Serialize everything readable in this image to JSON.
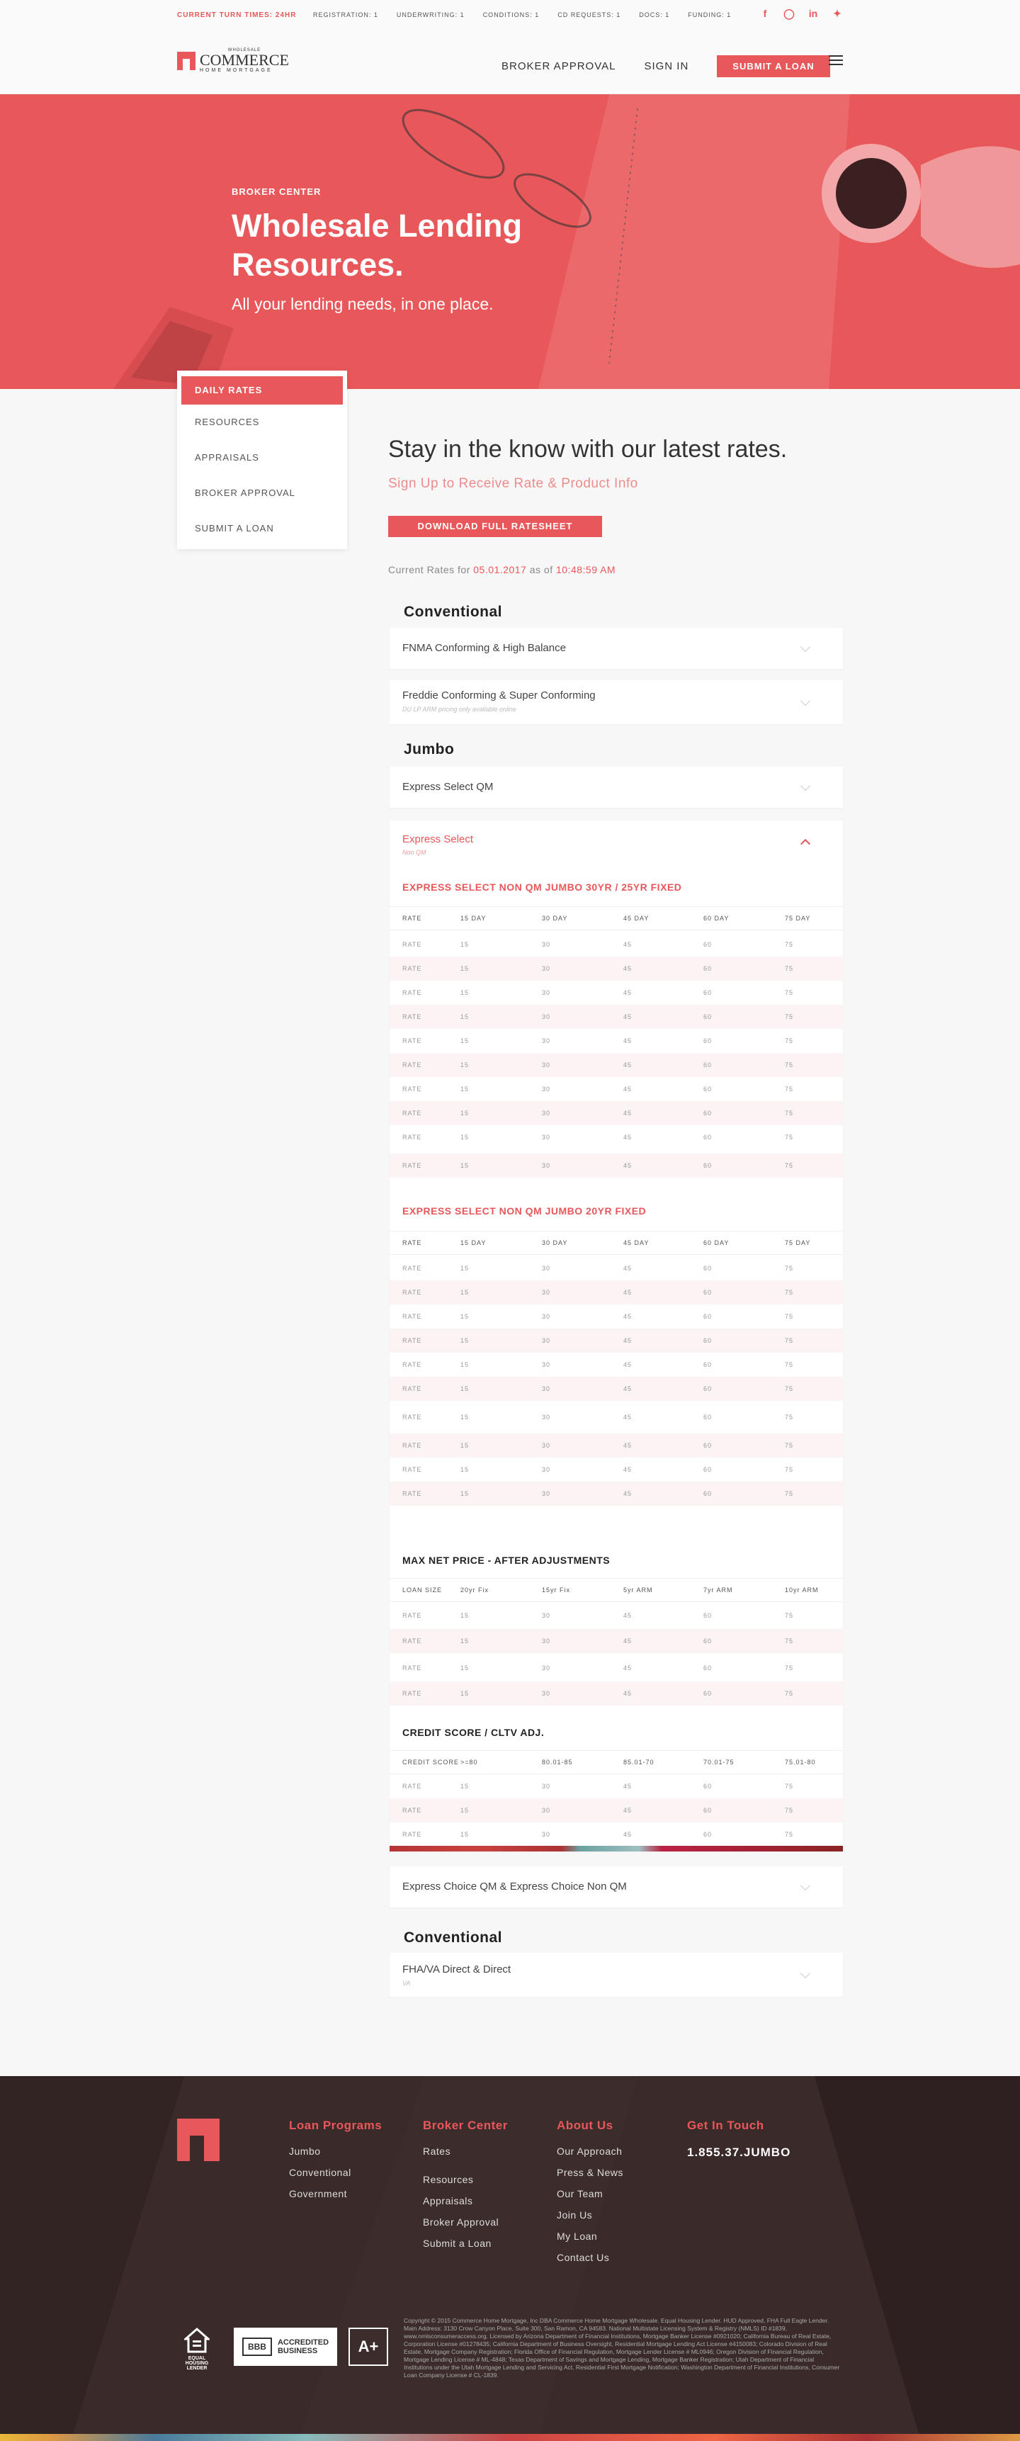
{
  "topbar": {
    "turn_times": "CURRENT TURN TIMES: 24HR",
    "stats": [
      "REGISTRATION: 1",
      "UNDERWRITING: 1",
      "CONDITIONS: 1",
      "CD REQUESTS: 1",
      "DOCS: 1",
      "FUNDING: 1"
    ],
    "social_icons": [
      "facebook-icon",
      "instagram-icon",
      "linkedin-icon",
      "twitter-icon"
    ]
  },
  "header": {
    "logo": {
      "wholesale": "WHOLESALE",
      "commerce": "COMMERCE",
      "home": "HOME MORTGAGE"
    },
    "nav": [
      "BROKER APPROVAL",
      "SIGN IN"
    ],
    "submit": "SUBMIT A LOAN"
  },
  "hero": {
    "kicker": "BROKER CENTER",
    "title": "Wholesale Lending Resources.",
    "subtitle": "All your lending needs, in one place."
  },
  "sidebar": {
    "items": [
      "DAILY RATES",
      "RESOURCES",
      "APPRAISALS",
      "BROKER APPROVAL",
      "SUBMIT A LOAN"
    ]
  },
  "main": {
    "title": "Stay in the know with our latest rates.",
    "signup": "Sign Up to Receive Rate & Product Info",
    "download": "DOWNLOAD FULL RATESHEET",
    "current_prefix": "Current Rates for",
    "current_date": "05.01.2017",
    "current_mid": "as of",
    "current_time": "10:48:59 AM",
    "sections": {
      "conventional": "Conventional",
      "jumbo": "Jumbo",
      "conventional2": "Conventional"
    },
    "cards": {
      "fnma": "FNMA Conforming & High Balance",
      "freddie": "Freddie Conforming & Super Conforming",
      "freddie_note": "DU LP ARM pricing only available online",
      "express_qm": "Express Select QM",
      "express": "Express Select",
      "express_note": "Non QM",
      "express_choice": "Express Choice QM & Express Choice Non QM",
      "fha": "FHA/VA Direct & Direct",
      "fha_note": "VA"
    },
    "tables": {
      "t1_title": "EXPRESS SELECT NON QM JUMBO 30YR / 25YR FIXED",
      "t2_title": "EXPRESS SELECT NON QM JUMBO 20YR FIXED",
      "t3_title": "MAX NET PRICE - AFTER ADJUSTMENTS",
      "t4_title": "CREDIT SCORE / CLTV ADJ.",
      "day_header": [
        "RATE",
        "15 DAY",
        "30 DAY",
        "45 DAY",
        "60 DAY",
        "75 DAY"
      ],
      "loan_header": [
        "LOAN SIZE",
        "20yr Fix",
        "15yr Fix",
        "5yr ARM",
        "7yr ARM",
        "10yr ARM"
      ],
      "credit_header": [
        "CREDIT SCORE",
        ">=80",
        "80.01-85",
        "85.01-70",
        "70.01-75",
        "75.01-80"
      ],
      "row_values": [
        "RATE",
        "15",
        "30",
        "45",
        "60",
        "75"
      ]
    }
  },
  "footer": {
    "col1": {
      "title": "Loan Programs",
      "links": [
        "Jumbo",
        "Conventional",
        "Government"
      ]
    },
    "col2": {
      "title": "Broker Center",
      "links": [
        "Rates",
        "Resources",
        "Appraisals",
        "Broker Approval",
        "Submit a Loan"
      ]
    },
    "col3": {
      "title": "About Us",
      "links": [
        "Our Approach",
        "Press & News",
        "Our Team",
        "Join Us",
        "My Loan",
        "Contact Us"
      ]
    },
    "col4": {
      "title": "Get In Touch",
      "phone": "1.855.37.JUMBO"
    },
    "badges": {
      "equal_housing": "EQUAL HOUSING LENDER",
      "bbb_1": "ACCREDITED",
      "bbb_2": "BUSINESS",
      "bbb_logo": "BBB",
      "rating": "A+"
    },
    "legal": "Copyright © 2015 Commerce Home Mortgage, Inc DBA Commerce Home Mortgage Wholesale. Equal Housing Lender. HUD Approved, FHA Full Eagle Lender. Main Address: 3130 Crow Canyon Place, Suite 300, San Ramon, CA 94583. National Multistate Licensing System & Registry (NMLS) ID #1839, www.nmlsconsumeraccess.org. Licensed by Arizona Department of Financial Institutions, Mortgage Banker License #0921020; California Bureau of Real Estate, Corporation License #01278435; California Department of Business Oversight, Residential Mortgage Lending Act License #4150083; Colorado Division of Real Estate, Mortgage Company Registration; Florida Office of Financial Regulation, Mortgage Lender License # ML0946; Oregon Division of Financial Regulation, Mortgage Lending License # ML-4848; Texas Department of Savings and Mortgage Lending, Mortgage Banker Registration; Utah Department of Financial Institutions under the Utah Mortgage Lending and Servicing Act, Residential First Mortgage Notification; Washington Department of Financial Institutions, Consumer Loan Company License # CL-1839."
  },
  "colors": {
    "accent": "#e8575a",
    "footer_bg": "#3a2a2a"
  }
}
